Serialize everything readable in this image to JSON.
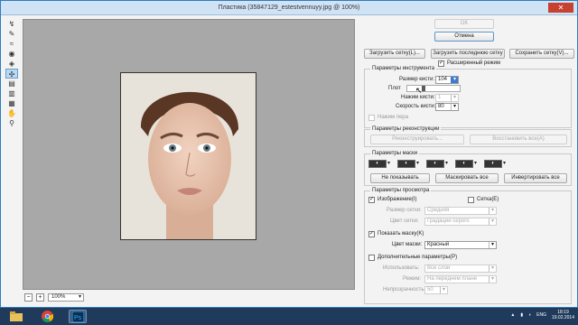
{
  "window": {
    "title": "Пластика (35847129_estestvennuyy.jpg @ 100%)"
  },
  "canvas": {
    "zoom": "100%"
  },
  "buttons": {
    "ok": "OK",
    "cancel": "Отмена",
    "load_mesh": "Загрузить сетку(L)...",
    "load_last_mesh": "Загрузить последнюю сетку",
    "save_mesh": "Сохранить сетку(V)..."
  },
  "advanced_mode": {
    "label": "Расширенный режим",
    "checked": true
  },
  "tool_options": {
    "title": "Параметры инструмента",
    "brush_size_label": "Размер кисти:",
    "brush_size_value": "104",
    "density_label": "Плот",
    "pressure_label": "Нажим кисти:",
    "pressure_value": "1",
    "rate_label": "Скорость кисти:",
    "rate_value": "80",
    "stylus_label": "Нажим пера"
  },
  "reconstruct": {
    "title": "Параметры реконструкции",
    "reconstruct_button": "Реконструировать...",
    "restore_all_button": "Восстановить все(A)"
  },
  "mask": {
    "title": "Параметры маски",
    "none_button": "Не показывать",
    "mask_all_button": "Маскировать все",
    "invert_all_button": "Инвертировать все"
  },
  "view": {
    "title": "Параметры просмотра",
    "image_label": "Изображение(I)",
    "mesh_label": "Сетка(E)",
    "mesh_size_label": "Размер сетки:",
    "mesh_size_value": "Средняя",
    "mesh_color_label": "Цвет сетки:",
    "mesh_color_value": "Градации серого",
    "show_mask_label": "Показать маску(K)",
    "mask_color_label": "Цвет маски:",
    "mask_color_value": "Красный",
    "backdrop_label": "Дополнительные параметры(P)",
    "use_label": "Использовать:",
    "use_value": "Все слои",
    "mode_label": "Режим:",
    "mode_value": "На переднем плане",
    "opacity_label": "Непрозрачность:",
    "opacity_value": "50"
  },
  "taskbar": {
    "language": "ENG",
    "time": "18:19",
    "date": "19.02.2014"
  }
}
